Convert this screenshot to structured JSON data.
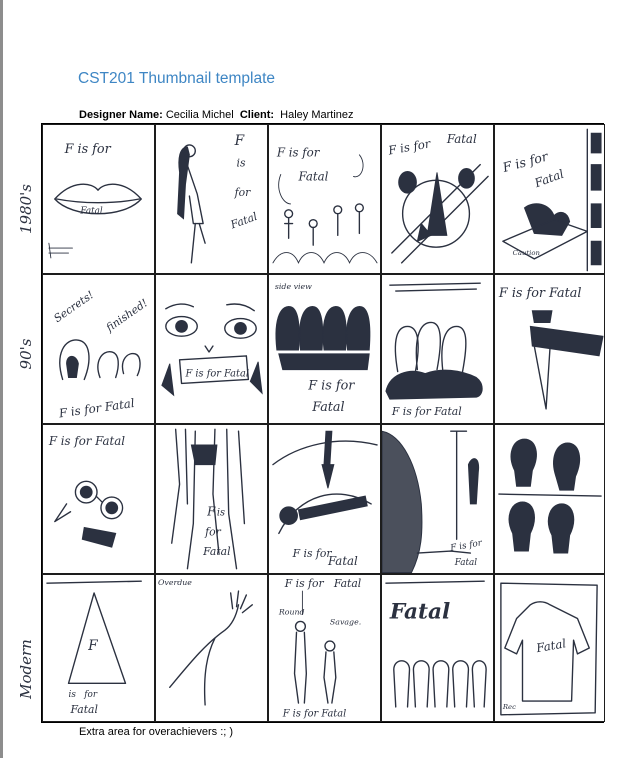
{
  "document": {
    "title": "CST201 Thumbnail template",
    "designer_label": "Designer Name:",
    "designer_value": "Cecilia Michel",
    "client_label": "Client:",
    "client_value": "Haley Martinez",
    "footer_note": "Extra area for overachievers :; )"
  },
  "rows": [
    {
      "label": "1980's"
    },
    {
      "label": "90's"
    },
    {
      "label": ""
    },
    {
      "label": "Modern"
    }
  ],
  "sketch_text": {
    "f_is_for": "F is for",
    "fatal": "Fatal",
    "f_is_for_fatal": "F is for Fatal",
    "secrets": "Secrets!",
    "finished": "finished!",
    "f_stacked": "F",
    "is_stacked": "is",
    "for_stacked": "for",
    "overdue": "Overdue",
    "round": "Round",
    "savage": "Savage.",
    "caution": "Caution",
    "side_view": "side view",
    "rec": "Rec"
  }
}
